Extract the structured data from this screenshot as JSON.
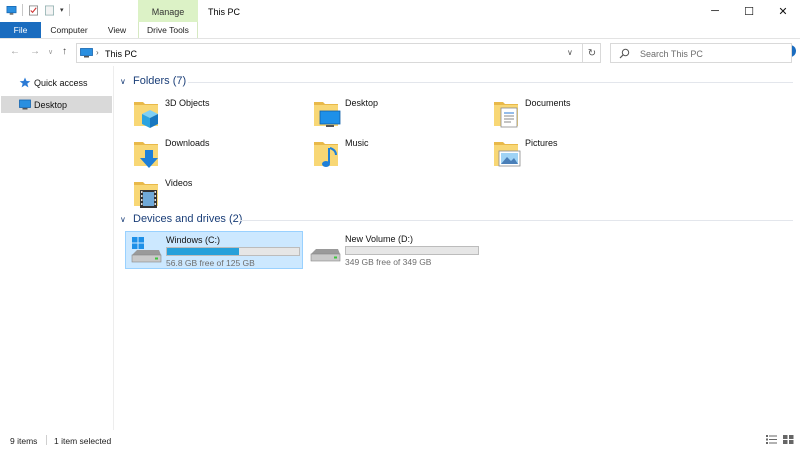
{
  "window": {
    "title": "This PC",
    "context_tab": "Manage",
    "controls": {
      "minimize": "─",
      "maximize": "☐",
      "close": "✕"
    }
  },
  "ribbon": {
    "tabs": {
      "file": "File",
      "computer": "Computer",
      "view": "View",
      "drive_tools": "Drive Tools"
    },
    "expand_glyph": "∨",
    "help_glyph": "?"
  },
  "quick_access_toolbar": {
    "customize_glyph": "▾"
  },
  "nav": {
    "back": "←",
    "forward": "→",
    "recent": "∨",
    "up": "↑"
  },
  "address": {
    "separator": "›",
    "path": "This PC",
    "dropdown": "∨",
    "refresh": "↻"
  },
  "search": {
    "placeholder": "Search This PC"
  },
  "sidebar": {
    "items": [
      {
        "label": "Quick access",
        "icon": "star-icon"
      },
      {
        "label": "Desktop",
        "icon": "desktop-icon",
        "selected": true
      }
    ]
  },
  "groups": {
    "folders": {
      "arrow": "∨",
      "title": "Folders (7)"
    },
    "drives": {
      "arrow": "∨",
      "title": "Devices and drives (2)"
    }
  },
  "folders": [
    {
      "name": "3D Objects",
      "icon": "folder-3d-objects-icon"
    },
    {
      "name": "Desktop",
      "icon": "folder-desktop-icon"
    },
    {
      "name": "Documents",
      "icon": "folder-documents-icon"
    },
    {
      "name": "Downloads",
      "icon": "folder-downloads-icon"
    },
    {
      "name": "Music",
      "icon": "folder-music-icon"
    },
    {
      "name": "Pictures",
      "icon": "folder-pictures-icon"
    },
    {
      "name": "Videos",
      "icon": "folder-videos-icon"
    }
  ],
  "drives": [
    {
      "name": "Windows (C:)",
      "free_text": "56.8 GB free of 125 GB",
      "used_fraction": 0.546,
      "selected": true,
      "icon": "windows-drive-icon"
    },
    {
      "name": "New Volume (D:)",
      "free_text": "349 GB free of 349 GB",
      "used_fraction": 0.0,
      "selected": false,
      "icon": "hard-drive-icon"
    }
  ],
  "status": {
    "item_count": "9 items",
    "selection": "1 item selected"
  },
  "colors": {
    "accent": "#1a6cbf",
    "context_tab": "#dcf2c6",
    "selection_bg": "#cce8ff",
    "selection_border": "#99d1ff",
    "drive_bar": "#26a0da",
    "group_title": "#1a3e78",
    "folder_yellow": "#f8d775"
  }
}
